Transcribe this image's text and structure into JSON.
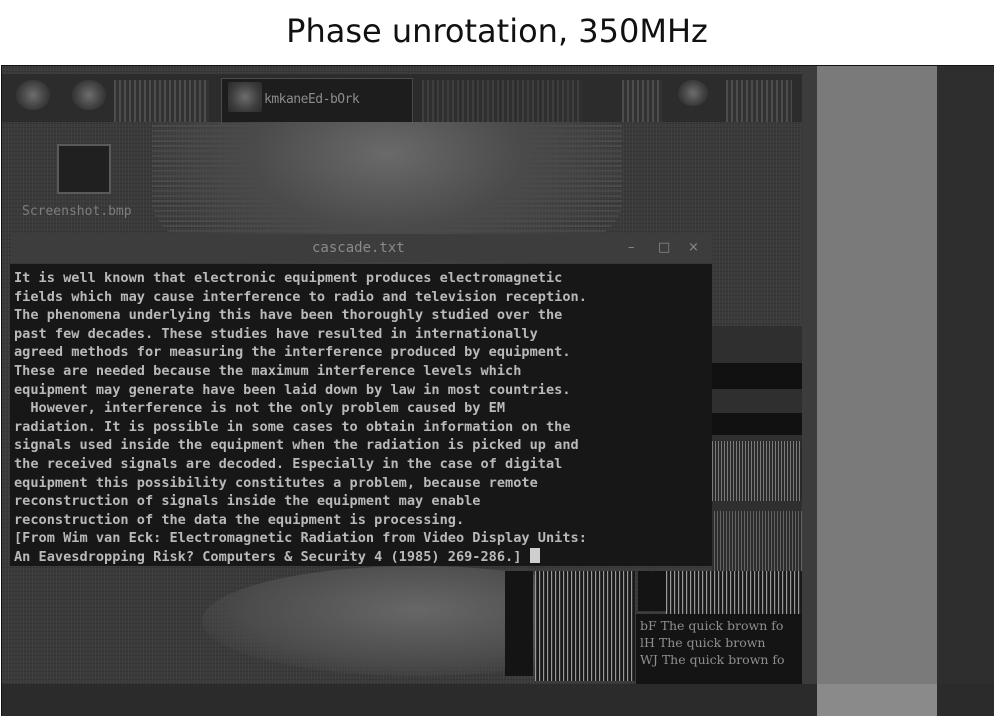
{
  "title": "Phase unrotation, 350MHz",
  "taskbar": {
    "active_label": "kmkaneEd-bOrk"
  },
  "desktop": {
    "icon_label": "Screenshot.bmp"
  },
  "window": {
    "title": "cascade.txt",
    "controls": [
      "–",
      "□",
      "×"
    ]
  },
  "terminal_lines": [
    "It is well known that electronic equipment produces electromagnetic",
    "fields which may cause interference to radio and television reception.",
    "The phenomena underlying this have been thoroughly studied over the",
    "past few decades. These studies have resulted in internationally",
    "agreed methods for measuring the interference produced by equipment.",
    "These are needed because the maximum interference levels which",
    "equipment may generate have been laid down by law in most countries.",
    "  However, interference is not the only problem caused by EM",
    "radiation. It is possible in some cases to obtain information on the",
    "signals used inside the equipment when the radiation is picked up and",
    "the received signals are decoded. Especially in the case of digital",
    "equipment this possibility constitutes a problem, because remote",
    "reconstruction of signals inside the equipment may enable",
    "reconstruction of the data the equipment is processing.",
    "[From Wim van Eck: Electromagnetic Radiation from Video Display Units:",
    "An Eavesdropping Risk? Computers & Security 4 (1985) 269-286.]"
  ],
  "quick_lines": [
    "bF The quick brown fo",
    "lH The quick brown",
    "WJ The quick brown fo"
  ],
  "colors": {
    "background": "#3a3a3a",
    "terminal": "#171717",
    "text": "#b9b9b9",
    "stripe_light": "#7a7a7a"
  }
}
